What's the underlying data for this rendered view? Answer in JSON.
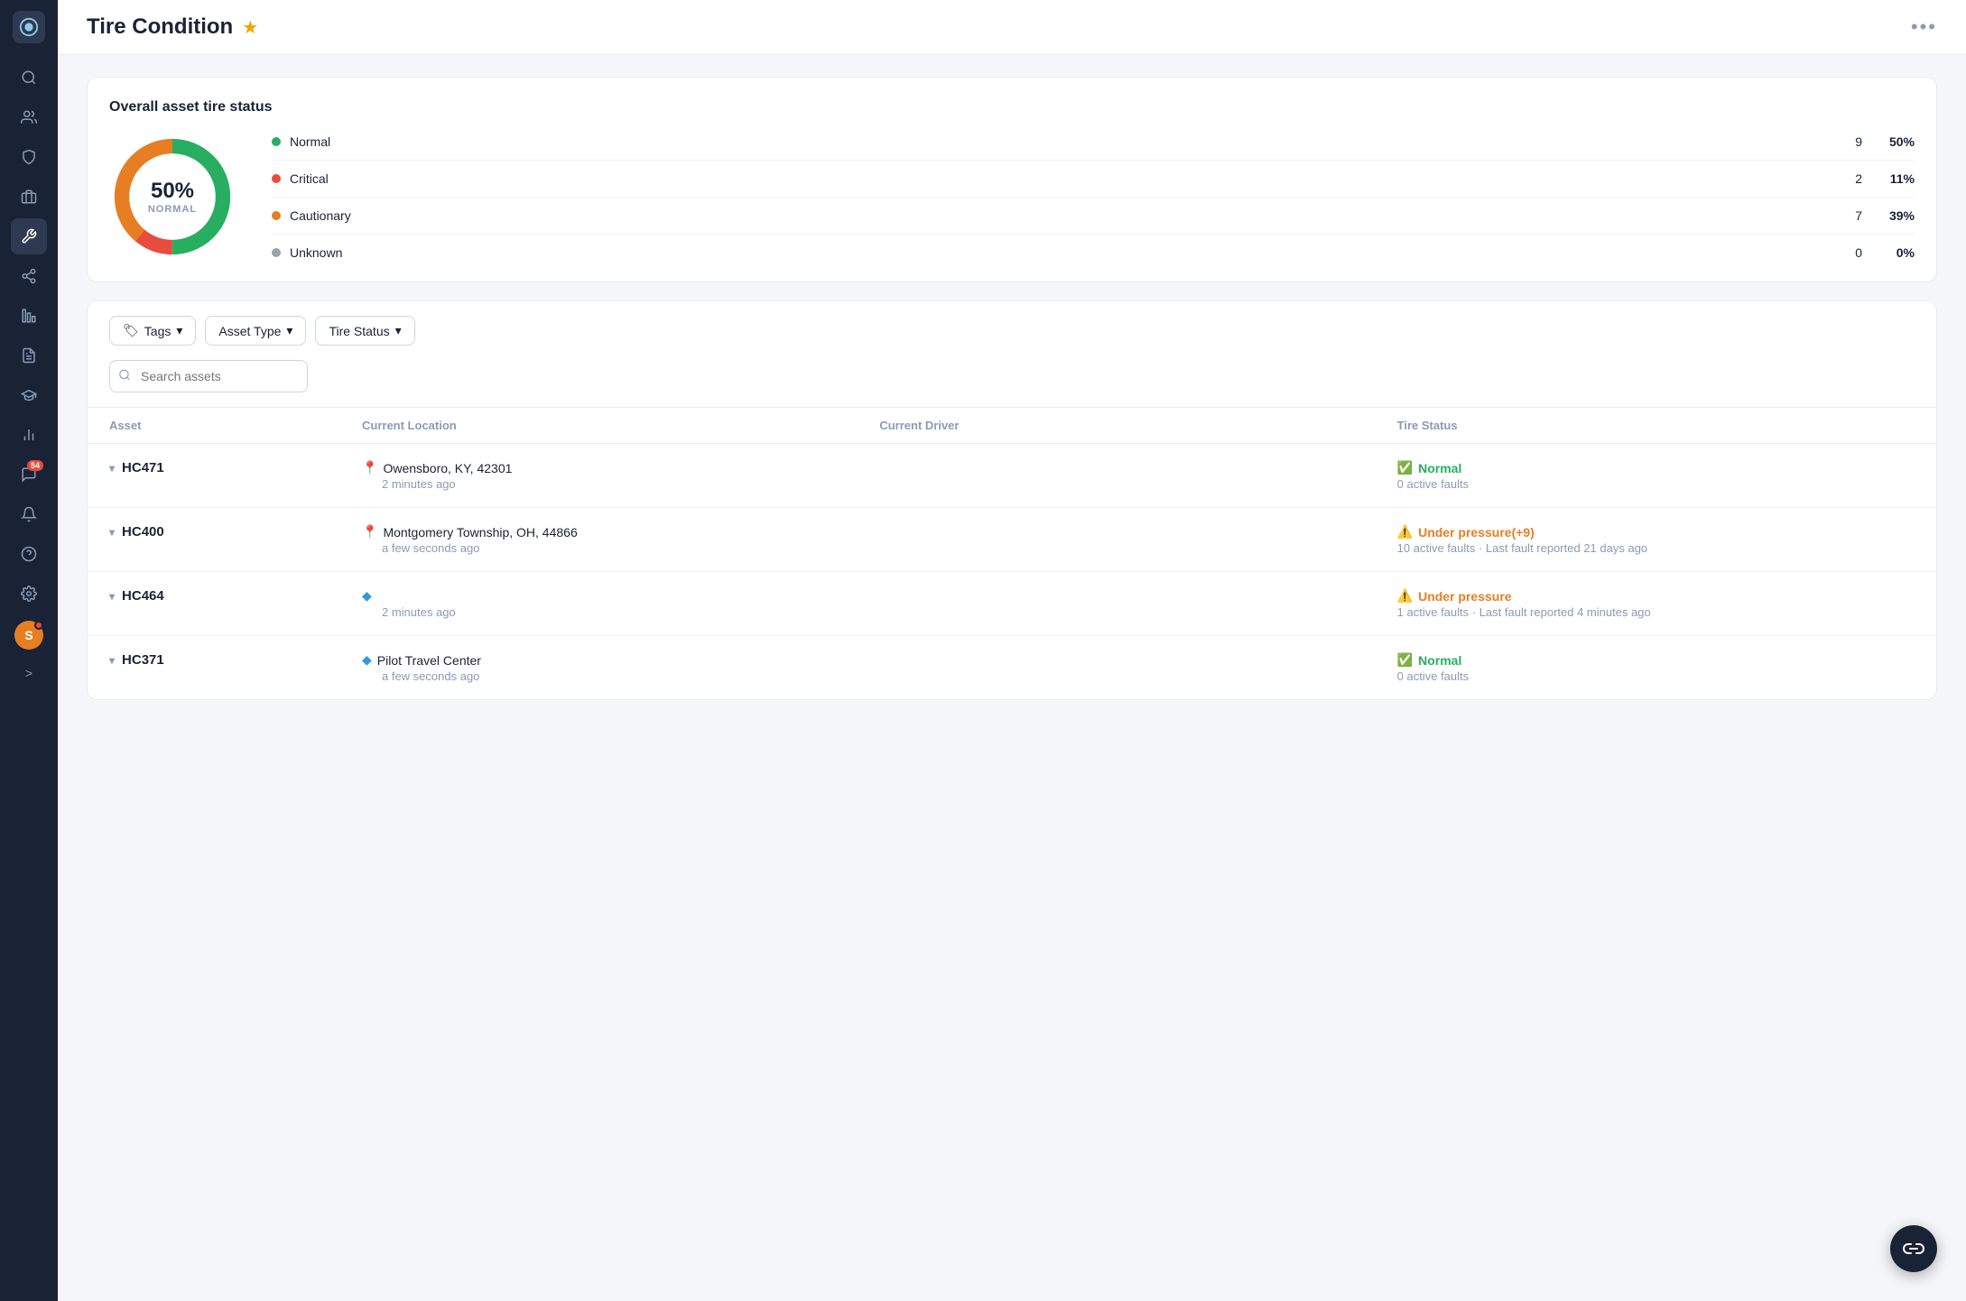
{
  "page": {
    "title": "Tire Condition"
  },
  "sidebar": {
    "expand_label": ">",
    "avatar_letter": "S",
    "notification_count": "54"
  },
  "overall_status": {
    "section_title": "Overall asset tire status",
    "donut_center_pct": "50%",
    "donut_center_label": "NORMAL",
    "legend": [
      {
        "label": "Normal",
        "count": "9",
        "pct": "50%",
        "color": "#27ae60"
      },
      {
        "label": "Critical",
        "count": "2",
        "pct": "11%",
        "color": "#e74c3c"
      },
      {
        "label": "Cautionary",
        "count": "7",
        "pct": "39%",
        "color": "#e67e22"
      },
      {
        "label": "Unknown",
        "count": "0",
        "pct": "0%",
        "color": "#95a5a6"
      }
    ]
  },
  "filters": {
    "tags_label": "Tags",
    "asset_type_label": "Asset Type",
    "tire_status_label": "Tire Status"
  },
  "search": {
    "placeholder": "Search assets"
  },
  "table": {
    "headers": [
      "Asset",
      "Current Location",
      "Current Driver",
      "Tire Status"
    ],
    "rows": [
      {
        "id": "HC471",
        "location": "Owensboro, KY, 42301",
        "location_time": "2 minutes ago",
        "location_icon": "green",
        "driver": "",
        "tire_status": "Normal",
        "tire_status_type": "normal",
        "tire_detail": "0 active faults"
      },
      {
        "id": "HC400",
        "location": "Montgomery Township, OH, 44866",
        "location_time": "a few seconds ago",
        "location_icon": "green",
        "driver": "",
        "tire_status": "Under pressure(+9)",
        "tire_status_type": "warning",
        "tire_detail": "10 active faults · Last fault reported 21 days ago"
      },
      {
        "id": "HC464",
        "location": "",
        "location_time": "2 minutes ago",
        "location_icon": "blue",
        "driver": "",
        "tire_status": "Under pressure",
        "tire_status_type": "warning",
        "tire_detail": "1 active faults · Last fault reported 4 minutes ago"
      },
      {
        "id": "HC371",
        "location": "Pilot Travel Center",
        "location_time": "a few seconds ago",
        "location_icon": "blue",
        "driver": "",
        "tire_status": "Normal",
        "tire_status_type": "normal",
        "tire_detail": "0 active faults"
      }
    ]
  }
}
